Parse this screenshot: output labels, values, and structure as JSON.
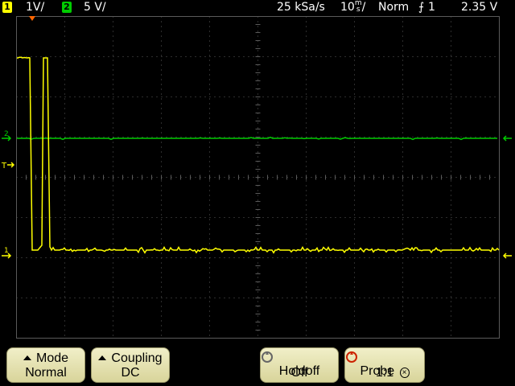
{
  "status": {
    "ch1_num": "1",
    "ch1_scale": "1V/",
    "ch2_num": "2",
    "ch2_scale": "5 V/",
    "sample_rate": "25 kSa/s",
    "timebase_num": "10",
    "timebase_unit_top": "m",
    "timebase_unit_bottom": "s",
    "timebase_suffix": "/",
    "trigger_mode": "Norm",
    "trigger_source": "1",
    "trigger_level": "2.35 V"
  },
  "markers": {
    "ch2_ground": "2",
    "ch1_ground": "1",
    "trigger_level": "T",
    "trigger_position": "T"
  },
  "softkeys": [
    {
      "title": "Mode",
      "value": "Normal",
      "icon": "triangle-up-icon"
    },
    {
      "title": "Coupling",
      "value": "DC",
      "icon": "triangle-up-icon"
    },
    {
      "title": "Holdoff",
      "value": "Off",
      "icon": "rotary-knob-icon"
    },
    {
      "title": "Probe",
      "value": "1:1",
      "icon": "rotary-knob-icon"
    }
  ],
  "colors": {
    "ch1": "#ffff00",
    "ch2": "#00cc00",
    "grid": "#5a5a5a",
    "trigger_marker": "#ff6600",
    "softkey": "#ebe8b8"
  }
}
